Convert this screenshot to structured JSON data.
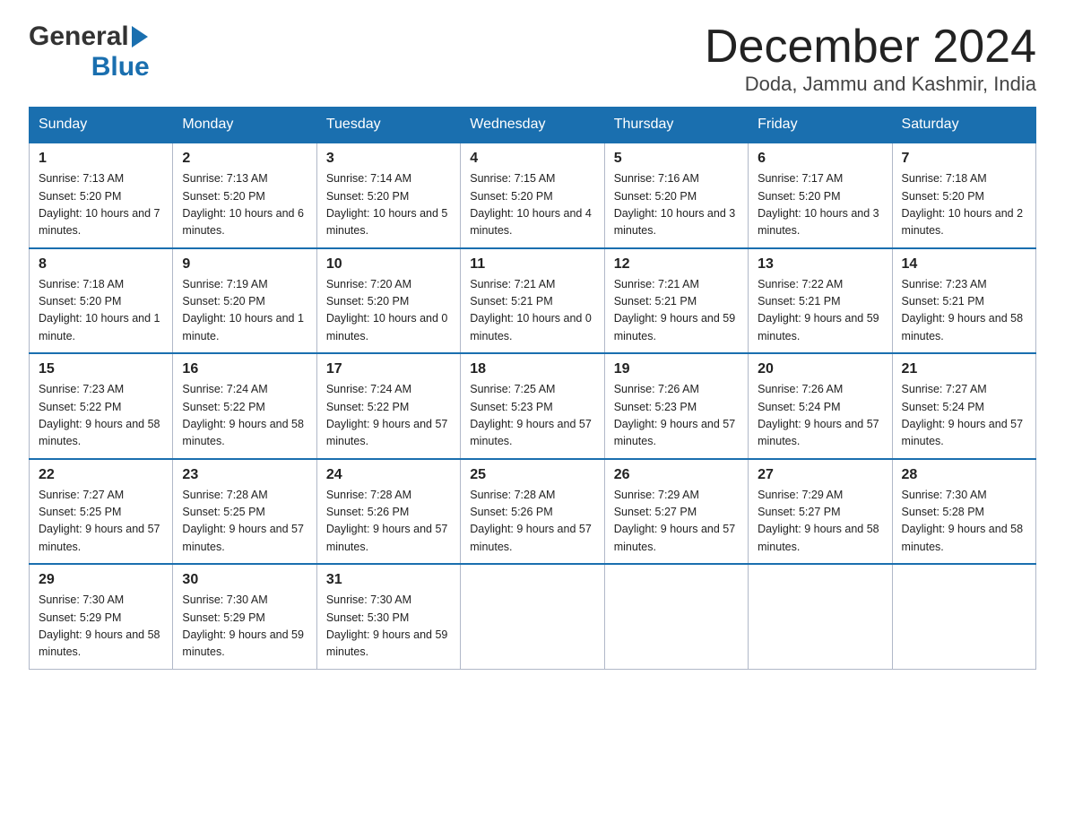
{
  "header": {
    "logo_general": "General",
    "logo_blue": "Blue",
    "month_title": "December 2024",
    "location": "Doda, Jammu and Kashmir, India"
  },
  "weekdays": [
    "Sunday",
    "Monday",
    "Tuesday",
    "Wednesday",
    "Thursday",
    "Friday",
    "Saturday"
  ],
  "weeks": [
    [
      {
        "day": "1",
        "sunrise": "7:13 AM",
        "sunset": "5:20 PM",
        "daylight": "10 hours and 7 minutes."
      },
      {
        "day": "2",
        "sunrise": "7:13 AM",
        "sunset": "5:20 PM",
        "daylight": "10 hours and 6 minutes."
      },
      {
        "day": "3",
        "sunrise": "7:14 AM",
        "sunset": "5:20 PM",
        "daylight": "10 hours and 5 minutes."
      },
      {
        "day": "4",
        "sunrise": "7:15 AM",
        "sunset": "5:20 PM",
        "daylight": "10 hours and 4 minutes."
      },
      {
        "day": "5",
        "sunrise": "7:16 AM",
        "sunset": "5:20 PM",
        "daylight": "10 hours and 3 minutes."
      },
      {
        "day": "6",
        "sunrise": "7:17 AM",
        "sunset": "5:20 PM",
        "daylight": "10 hours and 3 minutes."
      },
      {
        "day": "7",
        "sunrise": "7:18 AM",
        "sunset": "5:20 PM",
        "daylight": "10 hours and 2 minutes."
      }
    ],
    [
      {
        "day": "8",
        "sunrise": "7:18 AM",
        "sunset": "5:20 PM",
        "daylight": "10 hours and 1 minute."
      },
      {
        "day": "9",
        "sunrise": "7:19 AM",
        "sunset": "5:20 PM",
        "daylight": "10 hours and 1 minute."
      },
      {
        "day": "10",
        "sunrise": "7:20 AM",
        "sunset": "5:20 PM",
        "daylight": "10 hours and 0 minutes."
      },
      {
        "day": "11",
        "sunrise": "7:21 AM",
        "sunset": "5:21 PM",
        "daylight": "10 hours and 0 minutes."
      },
      {
        "day": "12",
        "sunrise": "7:21 AM",
        "sunset": "5:21 PM",
        "daylight": "9 hours and 59 minutes."
      },
      {
        "day": "13",
        "sunrise": "7:22 AM",
        "sunset": "5:21 PM",
        "daylight": "9 hours and 59 minutes."
      },
      {
        "day": "14",
        "sunrise": "7:23 AM",
        "sunset": "5:21 PM",
        "daylight": "9 hours and 58 minutes."
      }
    ],
    [
      {
        "day": "15",
        "sunrise": "7:23 AM",
        "sunset": "5:22 PM",
        "daylight": "9 hours and 58 minutes."
      },
      {
        "day": "16",
        "sunrise": "7:24 AM",
        "sunset": "5:22 PM",
        "daylight": "9 hours and 58 minutes."
      },
      {
        "day": "17",
        "sunrise": "7:24 AM",
        "sunset": "5:22 PM",
        "daylight": "9 hours and 57 minutes."
      },
      {
        "day": "18",
        "sunrise": "7:25 AM",
        "sunset": "5:23 PM",
        "daylight": "9 hours and 57 minutes."
      },
      {
        "day": "19",
        "sunrise": "7:26 AM",
        "sunset": "5:23 PM",
        "daylight": "9 hours and 57 minutes."
      },
      {
        "day": "20",
        "sunrise": "7:26 AM",
        "sunset": "5:24 PM",
        "daylight": "9 hours and 57 minutes."
      },
      {
        "day": "21",
        "sunrise": "7:27 AM",
        "sunset": "5:24 PM",
        "daylight": "9 hours and 57 minutes."
      }
    ],
    [
      {
        "day": "22",
        "sunrise": "7:27 AM",
        "sunset": "5:25 PM",
        "daylight": "9 hours and 57 minutes."
      },
      {
        "day": "23",
        "sunrise": "7:28 AM",
        "sunset": "5:25 PM",
        "daylight": "9 hours and 57 minutes."
      },
      {
        "day": "24",
        "sunrise": "7:28 AM",
        "sunset": "5:26 PM",
        "daylight": "9 hours and 57 minutes."
      },
      {
        "day": "25",
        "sunrise": "7:28 AM",
        "sunset": "5:26 PM",
        "daylight": "9 hours and 57 minutes."
      },
      {
        "day": "26",
        "sunrise": "7:29 AM",
        "sunset": "5:27 PM",
        "daylight": "9 hours and 57 minutes."
      },
      {
        "day": "27",
        "sunrise": "7:29 AM",
        "sunset": "5:27 PM",
        "daylight": "9 hours and 58 minutes."
      },
      {
        "day": "28",
        "sunrise": "7:30 AM",
        "sunset": "5:28 PM",
        "daylight": "9 hours and 58 minutes."
      }
    ],
    [
      {
        "day": "29",
        "sunrise": "7:30 AM",
        "sunset": "5:29 PM",
        "daylight": "9 hours and 58 minutes."
      },
      {
        "day": "30",
        "sunrise": "7:30 AM",
        "sunset": "5:29 PM",
        "daylight": "9 hours and 59 minutes."
      },
      {
        "day": "31",
        "sunrise": "7:30 AM",
        "sunset": "5:30 PM",
        "daylight": "9 hours and 59 minutes."
      },
      null,
      null,
      null,
      null
    ]
  ],
  "cell_labels": {
    "sunrise": "Sunrise: ",
    "sunset": "Sunset: ",
    "daylight": "Daylight: "
  }
}
